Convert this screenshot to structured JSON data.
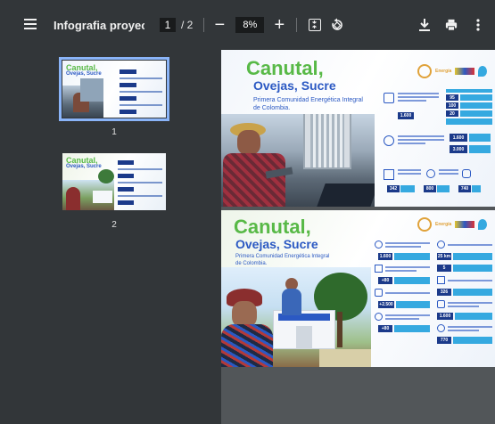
{
  "toolbar": {
    "menu_icon": "menu-icon",
    "document_title": "Infografia proyect...",
    "current_page": "1",
    "page_separator": "/ 2",
    "zoom_minus": "−",
    "zoom_level": "8%",
    "zoom_plus": "+",
    "fit_icon": "fit-page-icon",
    "rotate_icon": "rotate-icon",
    "download_icon": "download-icon",
    "print_icon": "print-icon",
    "more_icon": "more-vert-icon"
  },
  "sidebar": {
    "thumbnails": [
      {
        "label": "1",
        "selected": true
      },
      {
        "label": "2",
        "selected": false
      }
    ],
    "accent_color": "#8ab4f8"
  },
  "pages": [
    {
      "title_line1": "Canutal,",
      "title_line2": "Ovejas, Sucre",
      "subtitle": "Primera Comunidad Energética Integral de Colombia.",
      "logo_text": "Energía",
      "stats": [
        "95",
        "100",
        "20",
        "1.600",
        "1.600",
        "3.000",
        "342",
        "800",
        "740"
      ]
    },
    {
      "title_line1": "Canutal,",
      "title_line2": "Ovejas, Sucre",
      "subtitle": "Primera Comunidad Energética Integral de Colombia.",
      "logo_text": "Energía",
      "stats": [
        "1.600",
        "+80",
        "+2.500",
        "+80",
        "25 km",
        "5",
        "326",
        "1.600",
        "770"
      ]
    }
  ],
  "colors": {
    "toolbar_bg": "#323639",
    "viewer_bg": "#525659",
    "title_green": "#58b947",
    "title_blue": "#2b59c3",
    "stat_navy": "#1b3a8a"
  }
}
